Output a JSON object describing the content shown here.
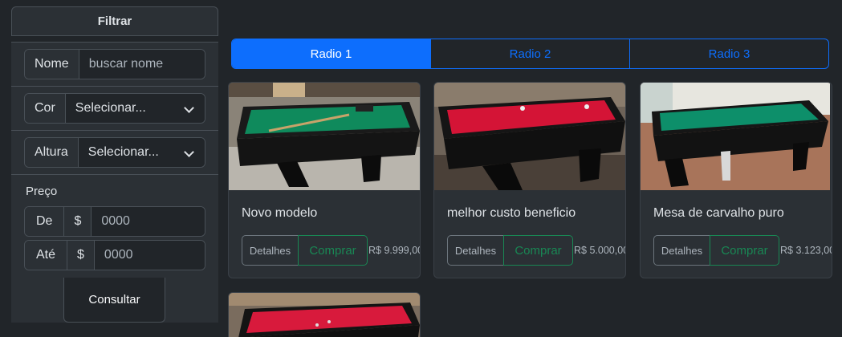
{
  "filter": {
    "header": "Filtrar",
    "name_label": "Nome",
    "name_placeholder": "buscar nome",
    "color_label": "Cor",
    "color_value": "Selecionar...",
    "height_label": "Altura",
    "height_value": "Selecionar...",
    "price_label": "Preço",
    "from_label": "De",
    "to_label": "Até",
    "currency": "$",
    "from_value": "0000",
    "to_value": "0000",
    "submit_label": "Consultar"
  },
  "radios": [
    {
      "label": "Radio 1",
      "active": true
    },
    {
      "label": "Radio 2",
      "active": false
    },
    {
      "label": "Radio 3",
      "active": false
    }
  ],
  "products": [
    {
      "title": "Novo modelo",
      "details_label": "Detalhes",
      "buy_label": "Comprar",
      "price": "R$ 9.999,00",
      "felt_color": "#0f8a5c"
    },
    {
      "title": "melhor custo beneficio",
      "details_label": "Detalhes",
      "buy_label": "Comprar",
      "price": "R$ 5.000,00",
      "felt_color": "#d41436"
    },
    {
      "title": "Mesa de carvalho puro",
      "details_label": "Detalhes",
      "buy_label": "Comprar",
      "price": "R$ 3.123,00",
      "felt_color": "#0d8f6a"
    },
    {
      "title": "",
      "details_label": "",
      "buy_label": "",
      "price": "",
      "felt_color": "#d81a3c"
    }
  ],
  "colors": {
    "background": "#212529",
    "panel": "#2b3035",
    "primary": "#0d6efd",
    "success": "#198754"
  }
}
